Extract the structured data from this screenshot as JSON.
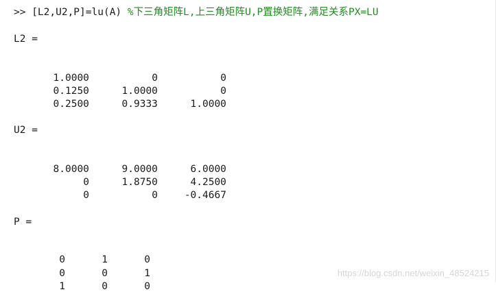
{
  "command": {
    "prompt": ">> ",
    "code": "[L2,U2,P]=lu(A) ",
    "comment": "%下三角矩阵L,上三角矩阵U,P置换矩阵,满足关系PX=LU"
  },
  "L2": {
    "label": "L2 =",
    "rows": [
      [
        "1.0000",
        "0",
        "0"
      ],
      [
        "0.1250",
        "1.0000",
        "0"
      ],
      [
        "0.2500",
        "0.9333",
        "1.0000"
      ]
    ]
  },
  "U2": {
    "label": "U2 =",
    "rows": [
      [
        "8.0000",
        "9.0000",
        "6.0000"
      ],
      [
        "0",
        "1.8750",
        "4.2500"
      ],
      [
        "0",
        "0",
        "-0.4667"
      ]
    ]
  },
  "P": {
    "label": "P =",
    "rows": [
      [
        "0",
        "1",
        "0"
      ],
      [
        "0",
        "0",
        "1"
      ],
      [
        "1",
        "0",
        "0"
      ]
    ]
  },
  "watermark": "https://blog.csdn.net/weixin_48524215",
  "colors": {
    "comment": "#228b22",
    "text": "#1a1a1a",
    "watermark": "#d6d6d6"
  }
}
